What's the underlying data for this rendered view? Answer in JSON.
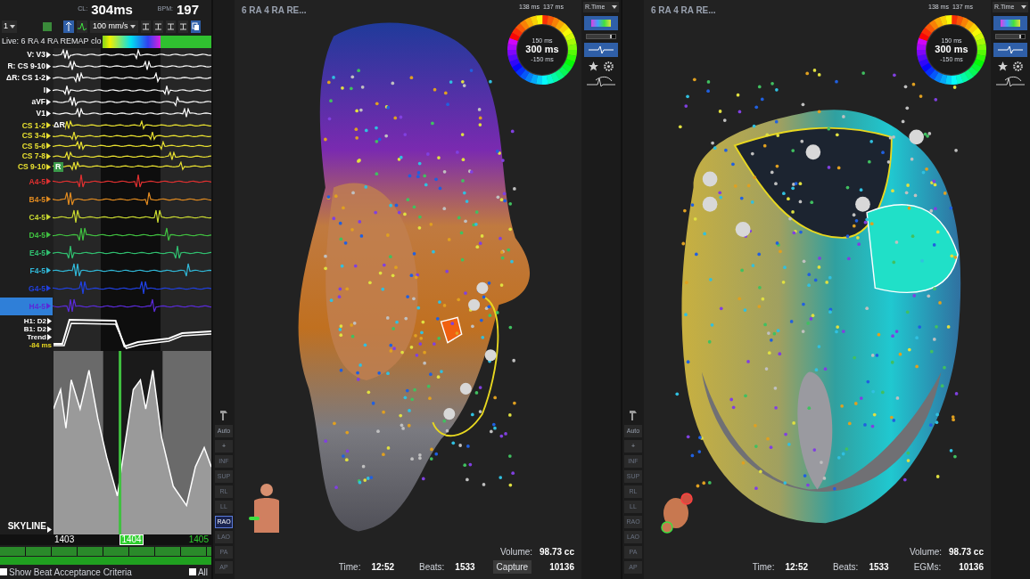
{
  "header": {
    "cl_label": "CL:",
    "cl": "304ms",
    "bpm_label": "BPM:",
    "bpm": "197"
  },
  "toolbar": {
    "channel_select": "1",
    "speed": "100 mm/s"
  },
  "live_bar": "Live: 6 RA 4 RA REMAP clo",
  "sections": [
    {
      "kind": "reference",
      "channels": [
        {
          "label": "V: V3",
          "color": "#ffffff",
          "selected": false
        },
        {
          "label": "R: CS 9-10",
          "color": "#ffffff",
          "selected": false
        },
        {
          "label": "ΔR: CS 1-2",
          "color": "#ffffff",
          "selected": false
        }
      ]
    },
    {
      "kind": "surface",
      "channels": [
        {
          "label": "I",
          "color": "#ffffff",
          "selected": false
        },
        {
          "label": "aVF",
          "color": "#ffffff",
          "selected": false
        },
        {
          "label": "V1",
          "color": "#ffffff",
          "selected": false
        }
      ]
    },
    {
      "kind": "cs",
      "channels": [
        {
          "label": "CS 1-2",
          "color": "#e8e030",
          "selected": false,
          "marker": {
            "kind": "plain",
            "text": "ΔR"
          }
        },
        {
          "label": "CS 3-4",
          "color": "#e8e030",
          "selected": false
        },
        {
          "label": "CS 5-6",
          "color": "#e8e030",
          "selected": false
        },
        {
          "label": "CS 7-8",
          "color": "#e8e030",
          "selected": false
        },
        {
          "label": "CS 9-10",
          "color": "#e8e030",
          "selected": false,
          "marker": {
            "kind": "badge",
            "text": "R"
          }
        }
      ]
    },
    {
      "kind": "catheter",
      "channels": [
        {
          "label": "A4-5",
          "color": "#e03030",
          "selected": false
        },
        {
          "label": "B4-5",
          "color": "#e08a20",
          "selected": false
        },
        {
          "label": "C4-5",
          "color": "#c8d830",
          "selected": false
        },
        {
          "label": "D4-5",
          "color": "#40c040",
          "selected": false
        },
        {
          "label": "E4-5",
          "color": "#30c070",
          "selected": false
        },
        {
          "label": "F4-5",
          "color": "#30b8d8",
          "selected": false
        },
        {
          "label": "G4-5",
          "color": "#2040e0",
          "selected": false
        },
        {
          "label": "H4-5",
          "color": "#5a2ad8",
          "selected": true
        }
      ]
    }
  ],
  "trend": {
    "labels": [
      "H1: D2",
      "B1: D2",
      "Trend"
    ],
    "value": "-84 ms"
  },
  "skyline": {
    "label": "SKYLINE",
    "beats": [
      {
        "label": "1403",
        "selected": false,
        "color": "#ffffff"
      },
      {
        "label": "1404",
        "selected": true,
        "color": "#2fcf2f"
      },
      {
        "label": "1405",
        "selected": false,
        "color": "#2fcf2f"
      }
    ]
  },
  "beat_acceptance": {
    "label": "Show Beat Acceptance Criteria",
    "checked": false
  },
  "all": {
    "label": "All",
    "checked": false
  },
  "maps": [
    {
      "title": "6 RA 4 RA RE...",
      "wheel": {
        "edge_labels": [
          "138 ms",
          "137 ms"
        ],
        "upper": "150 ms",
        "center": "300 ms",
        "lower": "-150 ms"
      },
      "mode": "R.Time",
      "opacity": {
        "level": 0.88
      },
      "side_tools": [
        "Auto",
        "+"
      ],
      "views": [
        {
          "label": "INF",
          "selected": false
        },
        {
          "label": "SUP",
          "selected": false
        },
        {
          "label": "RL",
          "selected": false
        },
        {
          "label": "LL",
          "selected": false
        },
        {
          "label": "RAO",
          "selected": true
        },
        {
          "label": "LAO",
          "selected": false
        },
        {
          "label": "PA",
          "selected": false
        },
        {
          "label": "AP",
          "selected": false
        }
      ],
      "stats": {
        "volume_label": "Volume:",
        "volume": "98.73 cc",
        "time_label": "Time:",
        "time": "12:52",
        "beats_label": "Beats:",
        "beats": "1533",
        "egms": "10136"
      },
      "capture": "Capture"
    },
    {
      "title": "6 RA 4 RA RE...",
      "wheel": {
        "edge_labels": [
          "138 ms",
          "137 ms"
        ],
        "upper": "150 ms",
        "center": "300 ms",
        "lower": "-150 ms"
      },
      "mode": "R.Time",
      "opacity": {
        "level": 0.88
      },
      "side_tools": [
        "Auto",
        "+"
      ],
      "views": [
        {
          "label": "INF",
          "selected": false
        },
        {
          "label": "SUP",
          "selected": false
        },
        {
          "label": "RL",
          "selected": false
        },
        {
          "label": "LL",
          "selected": false
        },
        {
          "label": "RAO",
          "selected": false
        },
        {
          "label": "LAO",
          "selected": false
        },
        {
          "label": "PA",
          "selected": false
        },
        {
          "label": "AP",
          "selected": false
        }
      ],
      "stats": {
        "volume_label": "Volume:",
        "volume": "98.73 cc",
        "time_label": "Time:",
        "time": "12:52",
        "beats_label": "Beats:",
        "beats": "1533",
        "egms_label": "EGMs:",
        "egms": "10136"
      }
    }
  ]
}
